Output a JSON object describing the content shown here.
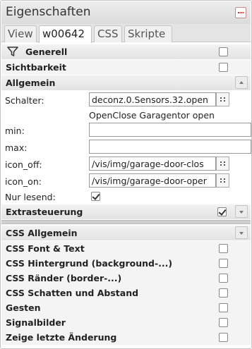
{
  "header": {
    "title": "Eigenschaften"
  },
  "tabs": [
    {
      "label": "View"
    },
    {
      "label": "w00642"
    },
    {
      "label": "CSS"
    },
    {
      "label": "Skripte"
    }
  ],
  "filter_row": {
    "label": "Generell",
    "checked": false
  },
  "visibility_row": {
    "label": "Sichtbarkeit",
    "checked": false
  },
  "general_group": {
    "label": "Allgemein",
    "fields": {
      "switch": {
        "label": "Schalter:",
        "value": "deconz.0.Sensors.32.open",
        "hint": "OpenClose Garagentor open"
      },
      "min": {
        "label": "min:",
        "value": ""
      },
      "max": {
        "label": "max:",
        "value": ""
      },
      "icon_off": {
        "label": "icon_off:",
        "value": "/vis/img/garage-door-clos"
      },
      "icon_on": {
        "label": "icon_on:",
        "value": "/vis/img/garage-door-oper"
      },
      "readonly": {
        "label": "Nur lesend:",
        "checked": true
      }
    }
  },
  "extra_group": {
    "label": "Extrasteuerung",
    "checked": true
  },
  "css_groups": [
    {
      "label": "CSS Allgemein"
    },
    {
      "label": "CSS Font & Text",
      "checked": false
    },
    {
      "label": "CSS Hintergrund (background-...)",
      "checked": false
    },
    {
      "label": "CSS Ränder (border-...)",
      "checked": false
    },
    {
      "label": "CSS Schatten und Abstand",
      "checked": false
    },
    {
      "label": "Gesten",
      "checked": false
    },
    {
      "label": "Signalbilder",
      "checked": false
    },
    {
      "label": "Zeige letzte Änderung",
      "checked": false
    }
  ],
  "icons": {
    "collapse": "panel-collapse-icon",
    "filter": "funnel-icon",
    "select": "object-picker-icon",
    "expand": "chevron-up-icon",
    "collapse_group": "chevron-down-icon"
  },
  "colors": {
    "header_bg": "#dcdcdc",
    "border": "#c5c5c5",
    "collapse_accent": "#cc3333"
  }
}
